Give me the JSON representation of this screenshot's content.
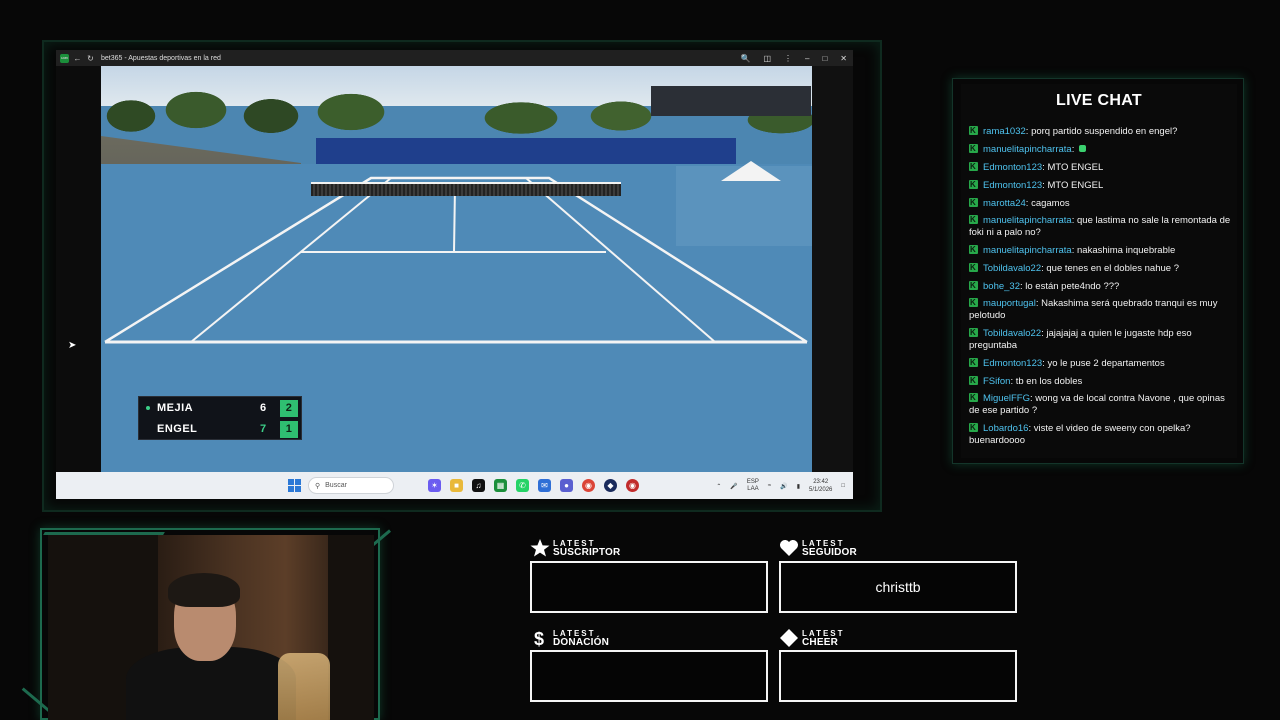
{
  "browser": {
    "title": "bet365 - Apuestas deportivas en la red",
    "favicon": "b365"
  },
  "scoreboard": {
    "players": [
      {
        "name": "MEJIA",
        "set": "6",
        "game": "2",
        "serving": true
      },
      {
        "name": "ENGEL",
        "set": "7",
        "game": "1",
        "serving": false
      }
    ]
  },
  "taskbar": {
    "search_placeholder": "Buscar",
    "language": "ESP",
    "layout": "LAA",
    "time": "23:42",
    "date": "5/1/2026"
  },
  "chat": {
    "title": "LIVE CHAT",
    "messages": [
      {
        "user": "rama1032",
        "text": "porq partido suspendido en engel?"
      },
      {
        "user": "manuelitapincharrata",
        "text": ""
      },
      {
        "user": "Edmonton123",
        "text": "MTO ENGEL"
      },
      {
        "user": "Edmonton123",
        "text": "MTO ENGEL"
      },
      {
        "user": "marotta24",
        "text": "cagamos"
      },
      {
        "user": "manuelitapincharrata",
        "text": "que lastima no sale la remontada de foki ni a palo no?"
      },
      {
        "user": "manuelitapincharrata",
        "text": "nakashima inquebrable"
      },
      {
        "user": "Tobildavalo22",
        "text": "que tenes en el dobles nahue ?"
      },
      {
        "user": "bohe_32",
        "text": "lo están pete4ndo ???"
      },
      {
        "user": "mauportugal",
        "text": "Nakashima será quebrado tranqui es muy pelotudo"
      },
      {
        "user": "Tobildavalo22",
        "text": "jajajajaj a quien le jugaste hdp eso preguntaba"
      },
      {
        "user": "Edmonton123",
        "text": "yo le puse 2 departamentos"
      },
      {
        "user": "FSifon",
        "text": "tb en los dobles"
      },
      {
        "user": "MiguelFFG",
        "text": "wong va de local contra Navone , que opinas de ese partido ?"
      },
      {
        "user": "Lobardo16",
        "text": "viste el video de sweeny con opelka? buenardoooo"
      }
    ]
  },
  "widgets": {
    "suscriptor": {
      "line1": "LATEST",
      "line2": "SUSCRIPTOR",
      "value": ""
    },
    "seguidor": {
      "line1": "LATEST",
      "line2": "SEGUIDOR",
      "value": "christtb"
    },
    "donacion": {
      "line1": "LATEST",
      "line2": "DONACIÓN",
      "value": ""
    },
    "cheer": {
      "line1": "LATEST",
      "line2": "CHEER",
      "value": ""
    }
  },
  "colors": {
    "accent_green": "#1d6a4e",
    "chat_user": "#4fc3ef",
    "score_green": "#2fbf71"
  }
}
